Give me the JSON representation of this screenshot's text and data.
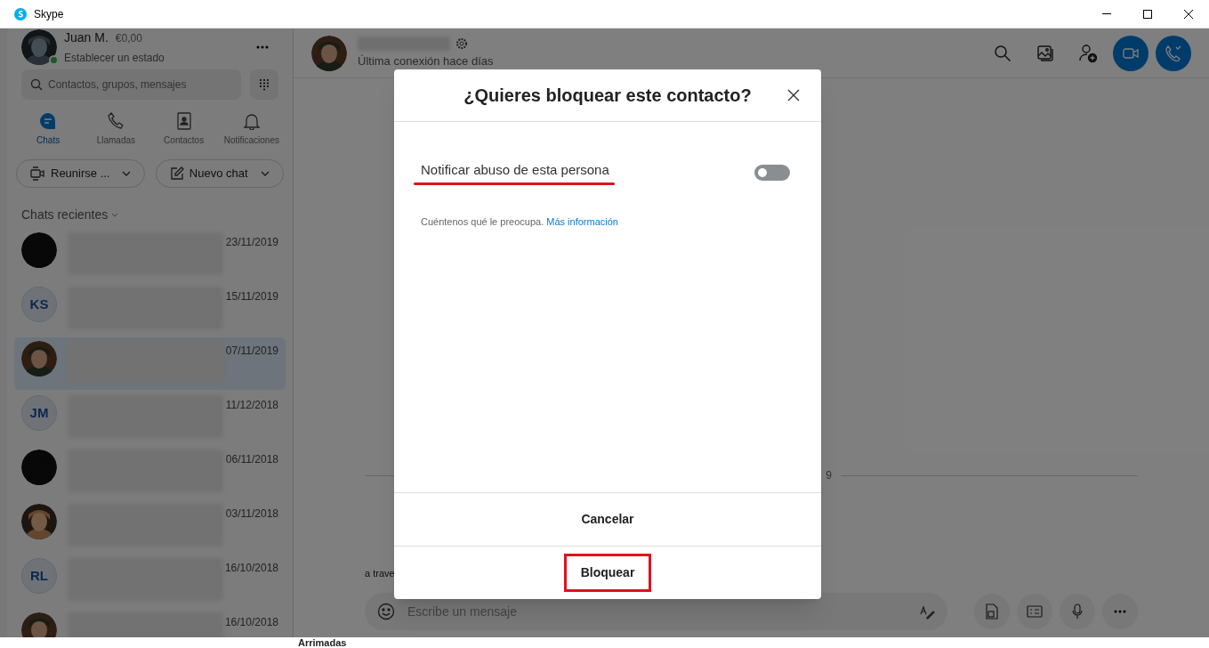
{
  "window": {
    "title": "Skype"
  },
  "profile": {
    "name": "Juan M.",
    "credit": "€0,00",
    "status": "Establecer un estado",
    "online": true
  },
  "search": {
    "placeholder": "Contactos, grupos, mensajes"
  },
  "nav_tabs": [
    {
      "label": "Chats",
      "kind": "chat",
      "selected": true
    },
    {
      "label": "Llamadas",
      "kind": "phone",
      "selected": false
    },
    {
      "label": "Contactos",
      "kind": "contacts",
      "selected": false
    },
    {
      "label": "Notificaciones",
      "kind": "bell",
      "selected": false
    }
  ],
  "actions": [
    {
      "label": "Reunirse ...",
      "kind": "meet"
    },
    {
      "label": "Nuevo chat",
      "kind": "compose"
    }
  ],
  "recent_header": "Chats recientes",
  "chats": [
    {
      "kind": "picture",
      "date": "23/11/2019",
      "selected": false
    },
    {
      "kind": "initials",
      "initials": "KS",
      "date": "15/11/2019",
      "selected": false
    },
    {
      "kind": "picture",
      "date": "07/11/2019",
      "selected": true
    },
    {
      "kind": "initials",
      "initials": "JM",
      "date": "11/12/2018",
      "selected": false
    },
    {
      "kind": "picture",
      "date": "06/11/2018",
      "selected": false
    },
    {
      "kind": "picture",
      "date": "03/11/2018",
      "selected": false
    },
    {
      "kind": "initials",
      "initials": "RL",
      "date": "16/10/2018",
      "selected": false
    },
    {
      "kind": "picture",
      "date": "16/10/2018",
      "selected": false
    }
  ],
  "conversation": {
    "last_seen": "Última conexión hace días",
    "date_divider": "9",
    "message": "a trave",
    "composer_placeholder": "Escribe un mensaje"
  },
  "dialog": {
    "title": "¿Quieres bloquear este contacto?",
    "toggle_label": "Notificar abuso de esta persona",
    "toggle_on": false,
    "hint": "Cuéntenos qué le preocupa.",
    "link": "Más información",
    "buttons": [
      {
        "label": "Cancelar",
        "highlighted": false
      },
      {
        "label": "Bloquear",
        "highlighted": true
      }
    ]
  },
  "background_page": {
    "text": "Arrimadas"
  }
}
